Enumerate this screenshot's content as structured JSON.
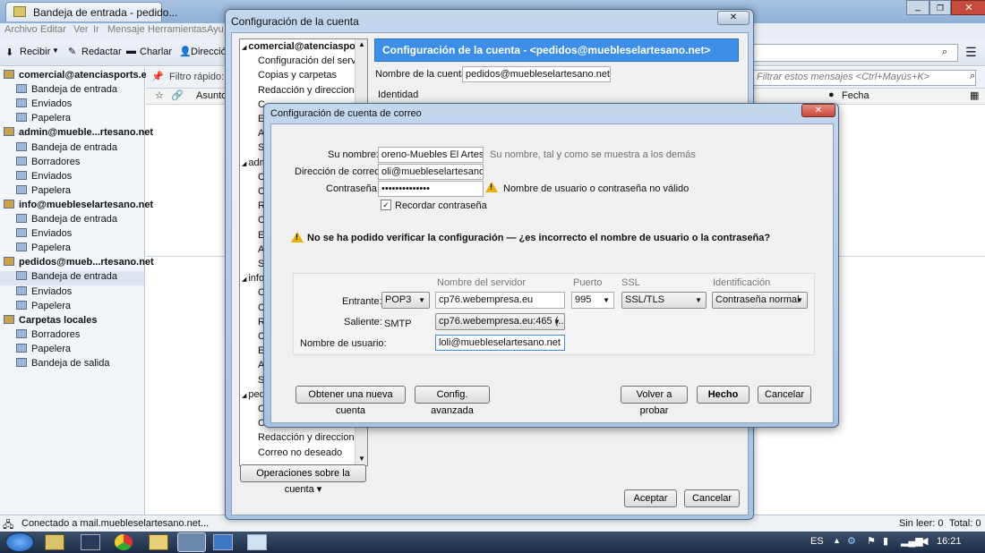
{
  "browser_tab": {
    "title": "Bandeja de entrada - pedido..."
  },
  "menu": [
    "Archivo",
    "Editar",
    "Ver",
    "Ir",
    "Mensaje",
    "Herramientas",
    "Ayu"
  ],
  "toolbar": {
    "receive": "Recibir",
    "compose": "Redactar",
    "chat": "Charlar",
    "directory": "Direcció"
  },
  "quickfilter": {
    "label": "Filtro rápido:",
    "subject_col": "Asunto",
    "search_placeholder": "Filtrar estos mensajes <Ctrl+Mayús+K>",
    "date_col": "Fecha"
  },
  "folders": [
    {
      "label": "comercial@atenciasports.es",
      "level": 0,
      "bold": true
    },
    {
      "label": "Bandeja de entrada",
      "level": 1
    },
    {
      "label": "Enviados",
      "level": 1
    },
    {
      "label": "Papelera",
      "level": 1
    },
    {
      "label": "admin@mueble...rtesano.net",
      "level": 0,
      "bold": true
    },
    {
      "label": "Bandeja de entrada",
      "level": 1
    },
    {
      "label": "Borradores",
      "level": 1
    },
    {
      "label": "Enviados",
      "level": 1
    },
    {
      "label": "Papelera",
      "level": 1
    },
    {
      "label": "info@muebleselartesano.net",
      "level": 0,
      "bold": true
    },
    {
      "label": "Bandeja de entrada",
      "level": 1
    },
    {
      "label": "Enviados",
      "level": 1
    },
    {
      "label": "Papelera",
      "level": 1
    },
    {
      "label": "pedidos@mueb...rtesano.net",
      "level": 0,
      "bold": true
    },
    {
      "label": "Bandeja de entrada",
      "level": 1,
      "selected": true
    },
    {
      "label": "Enviados",
      "level": 1
    },
    {
      "label": "Papelera",
      "level": 1
    },
    {
      "label": "Carpetas locales",
      "level": 0,
      "bold": true
    },
    {
      "label": "Borradores",
      "level": 1
    },
    {
      "label": "Papelera",
      "level": 1
    },
    {
      "label": "Bandeja de salida",
      "level": 1
    }
  ],
  "status": {
    "text": "Conectado a mail.muebleselartesano.net...",
    "unread": "Sin leer: 0",
    "total": "Total: 0"
  },
  "account_settings": {
    "title": "Configuración de la cuenta",
    "header": "Configuración de la cuenta - <pedidos@muebleselartesano.net>",
    "account_name_label": "Nombre de la cuenta:",
    "account_name_value": "pedidos@muebleselartesano.net",
    "identity_label": "Identidad",
    "tree": [
      {
        "label": "comercial@atenciaspor...",
        "bold": true
      },
      {
        "label": "Configuración del servi..."
      },
      {
        "label": "Copias y carpetas"
      },
      {
        "label": "Redacción y direcciones"
      },
      {
        "label": "C"
      },
      {
        "label": "E"
      },
      {
        "label": "A"
      },
      {
        "label": "S"
      },
      {
        "label": "adm"
      },
      {
        "label": "C"
      },
      {
        "label": "C"
      },
      {
        "label": "R"
      },
      {
        "label": "C"
      },
      {
        "label": "E"
      },
      {
        "label": "A"
      },
      {
        "label": "S"
      },
      {
        "label": "info"
      },
      {
        "label": "C"
      },
      {
        "label": "C"
      },
      {
        "label": "R"
      },
      {
        "label": "C"
      },
      {
        "label": "E"
      },
      {
        "label": "A"
      },
      {
        "label": "S"
      },
      {
        "label": "ped"
      },
      {
        "label": "C"
      },
      {
        "label": "C"
      },
      {
        "label": "Redacción y direcciones"
      },
      {
        "label": "Correo no deseado"
      }
    ],
    "ops_button": "Operaciones sobre la cuenta",
    "accept": "Aceptar",
    "cancel": "Cancelar"
  },
  "mail_dialog": {
    "title": "Configuración de cuenta de correo",
    "name_label": "Su nombre:",
    "name_value": "oreno-Muebles El Artesano",
    "name_hint": "Su nombre, tal y como se muestra a los demás",
    "email_label": "Dirección de correo:",
    "email_value": "oli@muebleselartesano.net",
    "password_label": "Contraseña:",
    "password_value": "••••••••••••••",
    "password_error": "Nombre de usuario o contraseña no válido",
    "remember_label": "Recordar contraseña",
    "remember_checked": true,
    "verify_error": "No se ha podido verificar la configuración — ¿es incorrecto el nombre de usuario o la contraseña?",
    "col_server": "Nombre del servidor",
    "col_port": "Puerto",
    "col_ssl": "SSL",
    "col_auth": "Identificación",
    "incoming_label": "Entrante:",
    "incoming_protocol": "POP3",
    "incoming_server": "cp76.webempresa.eu",
    "incoming_port": "995",
    "incoming_ssl": "SSL/TLS",
    "incoming_auth": "Contraseña normal",
    "outgoing_label": "Saliente:",
    "outgoing_protocol": "SMTP",
    "outgoing_server": "cp76.webempresa.eu:465 (...",
    "username_label": "Nombre de usuario:",
    "username_value": "loli@muebleselartesano.net",
    "btn_new_account": "Obtener una nueva cuenta",
    "btn_advanced": "Config. avanzada",
    "btn_retry": "Volver a probar",
    "btn_done": "Hecho",
    "btn_cancel": "Cancelar",
    "close": "x"
  },
  "taskbar": {
    "lang": "ES",
    "time": "16:21"
  },
  "colors": {
    "accent": "#3d8ee6",
    "warning": "#e8b400",
    "close_red": "#c74b3d",
    "taskbar": "#1c2c44"
  }
}
